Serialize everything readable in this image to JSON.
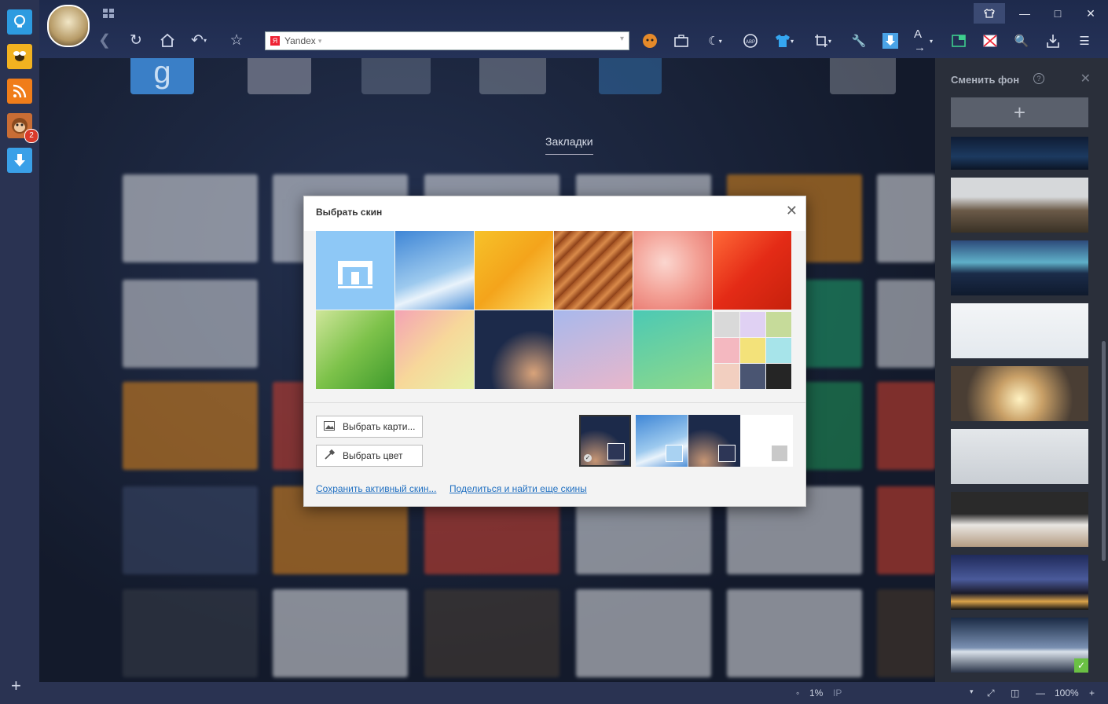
{
  "toolbar": {
    "address_text": "Yandex",
    "address_logo": "Я"
  },
  "extensions": {
    "badge_count": "2"
  },
  "newtab": {
    "bookmarks_label": "Закладки",
    "first_tile_letter": "g"
  },
  "dialog": {
    "title": "Выбрать скин",
    "choose_picture_label": "Выбрать карти...",
    "choose_color_label": "Выбрать цвет",
    "save_skin_link": "Сохранить активный скин...",
    "share_link": "Поделиться и найти еще скины"
  },
  "panel": {
    "title": "Сменить фон",
    "help_glyph": "?",
    "add_glyph": "+"
  },
  "status": {
    "speed": "1%",
    "zoom": "100%"
  }
}
